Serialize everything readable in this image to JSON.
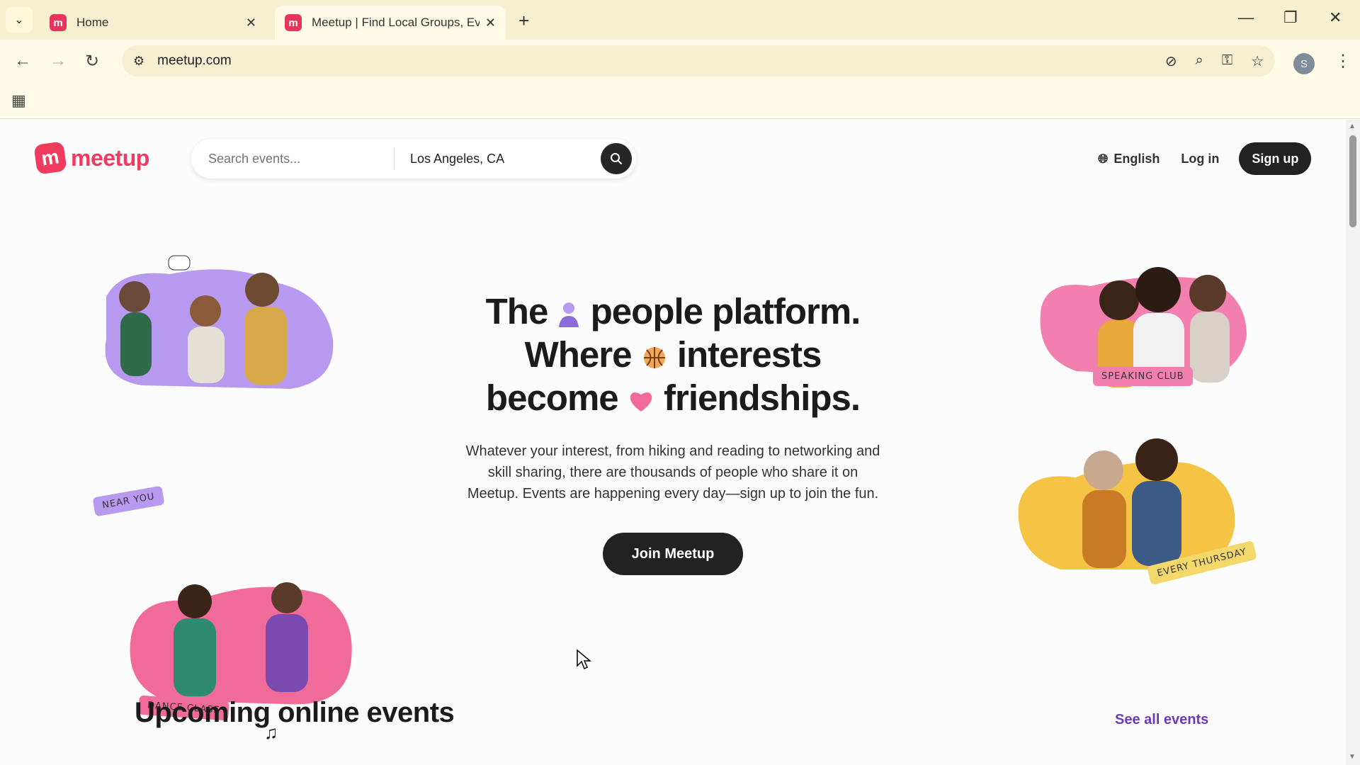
{
  "browser": {
    "tabs": [
      {
        "title": "Home",
        "active": false
      },
      {
        "title": "Meetup | Find Local Groups, Ev",
        "active": true
      }
    ],
    "url": "meetup.com",
    "profile_initial": "S"
  },
  "header": {
    "logo_text": "meetup",
    "search": {
      "placeholder": "Search events...",
      "location_value": "Los Angeles, CA"
    },
    "language": "English",
    "login": "Log in",
    "signup": "Sign up"
  },
  "hero": {
    "line1_a": "The",
    "line1_b": "people platform.",
    "line2_a": "Where",
    "line2_b": "interests",
    "line3_a": "become",
    "line3_b": "friendships.",
    "description": "Whatever your interest, from hiking and reading to networking and skill sharing, there are thousands of people who share it on Meetup. Events are happening every day—sign up to join the fun.",
    "cta": "Join Meetup"
  },
  "photos": {
    "near_you": "NEAR YOU",
    "dance_class": "DANCE CLASS",
    "speaking_club": "SPEAKING CLUB",
    "every_thursday": "EVERY THURSDAY"
  },
  "events": {
    "title": "Upcoming online events",
    "see_all": "See all events"
  },
  "colors": {
    "brand": "#f13a5e",
    "link": "#6c3bb9",
    "dark_button": "#222222"
  }
}
